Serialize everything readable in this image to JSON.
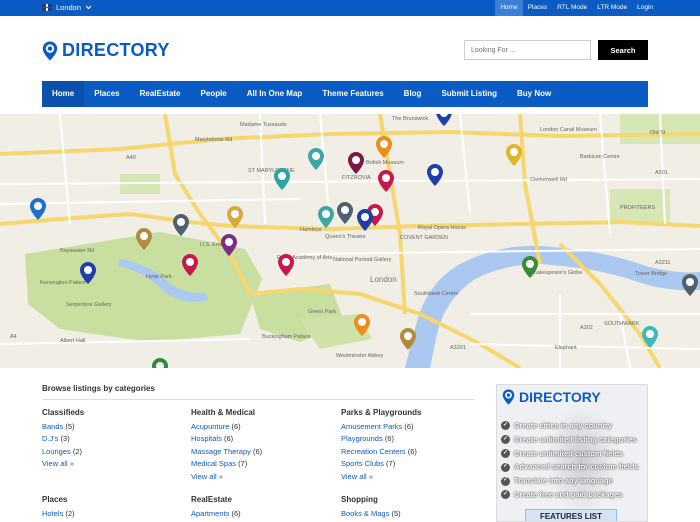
{
  "topbar": {
    "city": "London",
    "links": [
      "Home",
      "Places",
      "RTL Mode",
      "LTR Mode",
      "Login"
    ]
  },
  "header": {
    "logo_text": "DIRECTORY",
    "search_placeholder": "Looking For ...",
    "search_button": "Search"
  },
  "nav": {
    "items": [
      "Home",
      "Places",
      "RealEstate",
      "People",
      "All In One Map",
      "Theme Features",
      "Blog",
      "Submit Listing",
      "Buy Now"
    ]
  },
  "map": {
    "labels": [
      "The Brunswick",
      "Madame Tussauds",
      "Marylebone Rd",
      "British Museum",
      "FITZROVIA",
      "ST MARYLEBONE",
      "London Canal Museum",
      "Barbican Centre",
      "Old St",
      "Clerkenwell Rd",
      "PROFITEERS",
      "Royal Opera House",
      "COVENT GARDEN",
      "Hamleys",
      "Queen's Theatre",
      "U.S. Embassy",
      "Hyde Park",
      "Kensington Palace",
      "Serpentine Gallery",
      "Royal Academy of Arts",
      "National Portrait Gallery",
      "London",
      "Southbank Centre",
      "Shakespeare's Globe",
      "Tower Bridge",
      "Buckingham Palace",
      "Westminster Abbey",
      "Green Park",
      "Bayswater Rd",
      "Albert Hall",
      "SOUTHWARK",
      "Elephant",
      "A40",
      "A501",
      "A4",
      "A3211",
      "A302",
      "A3201"
    ],
    "colors": {
      "water": "#aac8f0",
      "park": "#c8dfa0",
      "road_major": "#f5d76e",
      "road_minor": "#ffffff"
    }
  },
  "categories": {
    "heading": "Browse listings by categories",
    "columns": [
      {
        "title": "Classifieds",
        "items": [
          {
            "name": "Bands",
            "count": "(5)"
          },
          {
            "name": "D.J's",
            "count": "(3)"
          },
          {
            "name": "Lounges",
            "count": "(2)"
          }
        ],
        "viewall": "View all »"
      },
      {
        "title": "Health & Medical",
        "items": [
          {
            "name": "Acupunture",
            "count": "(6)"
          },
          {
            "name": "Hospitals",
            "count": "(6)"
          },
          {
            "name": "Massage Therapy",
            "count": "(6)"
          },
          {
            "name": "Medical Spas",
            "count": "(7)"
          }
        ],
        "viewall": "View all »"
      },
      {
        "title": "Parks & Playgrounds",
        "items": [
          {
            "name": "Amusement Parks",
            "count": "(6)"
          },
          {
            "name": "Playgrounds",
            "count": "(6)"
          },
          {
            "name": "Recreation Centers",
            "count": "(6)"
          },
          {
            "name": "Sports Clubs",
            "count": "(7)"
          }
        ],
        "viewall": "View all »"
      },
      {
        "title": "Places",
        "items": [
          {
            "name": "Hotels",
            "count": "(2)"
          }
        ]
      },
      {
        "title": "RealEstate",
        "items": [
          {
            "name": "Apartments",
            "count": "(6)"
          }
        ]
      },
      {
        "title": "Shopping",
        "items": [
          {
            "name": "Books & Mags",
            "count": "(5)"
          }
        ]
      }
    ]
  },
  "ad": {
    "logo_text": "DIRECTORY",
    "features": [
      "Create cities in any country",
      "Create unlimited listing categories",
      "Create unlimited custom fields",
      "Advanced search for custom fields",
      "Translate into any language",
      "Create free and paid packages"
    ],
    "button": "FEATURES LIST"
  }
}
